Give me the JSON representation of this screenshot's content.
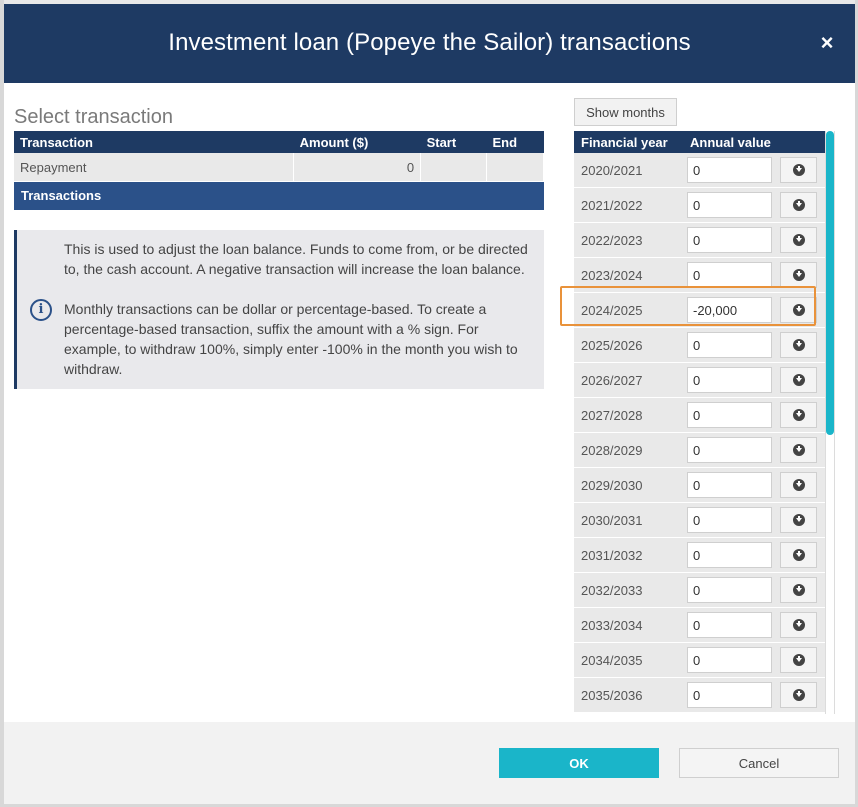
{
  "dialog": {
    "title": "Investment loan (Popeye the Sailor) transactions",
    "close_label": "×"
  },
  "select_transaction": {
    "heading": "Select transaction",
    "columns": [
      "Transaction",
      "Amount ($)",
      "Start",
      "End"
    ],
    "rows": [
      {
        "transaction": "Repayment",
        "amount": "0",
        "start": "",
        "end": ""
      }
    ],
    "section_label": "Transactions"
  },
  "info": {
    "icon": "info-icon",
    "paragraph1": "This is used to adjust the loan balance. Funds to come from, or be directed to, the cash account. A negative transaction will increase the loan balance.",
    "paragraph2": "Monthly transactions can be dollar or percentage-based. To create a percentage-based transaction, suffix the amount with a % sign. For example, to withdraw 100%, simply enter -100% in the month you wish to withdraw."
  },
  "schedule": {
    "show_months_label": "Show months",
    "col_year": "Financial year",
    "col_value": "Annual value",
    "rows": [
      {
        "year": "2020/2021",
        "value": "0"
      },
      {
        "year": "2021/2022",
        "value": "0"
      },
      {
        "year": "2022/2023",
        "value": "0"
      },
      {
        "year": "2023/2024",
        "value": "0"
      },
      {
        "year": "2024/2025",
        "value": "-20,000"
      },
      {
        "year": "2025/2026",
        "value": "0"
      },
      {
        "year": "2026/2027",
        "value": "0"
      },
      {
        "year": "2027/2028",
        "value": "0"
      },
      {
        "year": "2028/2029",
        "value": "0"
      },
      {
        "year": "2029/2030",
        "value": "0"
      },
      {
        "year": "2030/2031",
        "value": "0"
      },
      {
        "year": "2031/2032",
        "value": "0"
      },
      {
        "year": "2032/2033",
        "value": "0"
      },
      {
        "year": "2033/2034",
        "value": "0"
      },
      {
        "year": "2034/2035",
        "value": "0"
      },
      {
        "year": "2035/2036",
        "value": "0"
      }
    ],
    "highlighted_year": "2024/2025",
    "highlight_color": "#e9923a"
  },
  "footer": {
    "ok_label": "OK",
    "cancel_label": "Cancel"
  },
  "colors": {
    "header": "#1e3a63",
    "section_row": "#2b5189",
    "accent": "#1ab5c9"
  }
}
